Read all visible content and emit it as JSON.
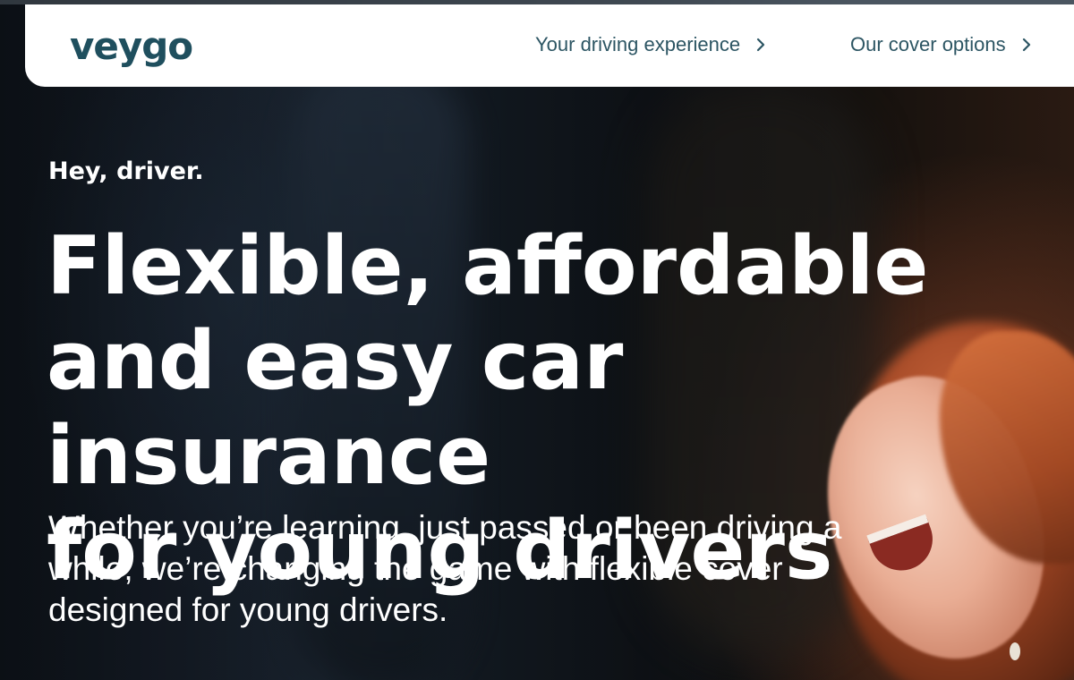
{
  "brand": {
    "logo_text": "veygo",
    "brand_color": "#1f4f5e"
  },
  "nav": {
    "items": [
      {
        "label": "Your driving experience",
        "icon": "chevron-right-icon"
      },
      {
        "label": "Our cover options",
        "icon": "chevron-right-icon"
      }
    ]
  },
  "hero": {
    "eyebrow": "Hey, driver.",
    "headline_lines": [
      "Flexible, affordable",
      "and easy car insurance",
      "for young drivers"
    ],
    "subtitle_lines": [
      "Whether you’re learning, just passed or been driving a",
      "while, we’re changing the game with flexible cover",
      "designed for young drivers."
    ],
    "background": "photo of a laughing young woman with red hair in a car seat"
  }
}
